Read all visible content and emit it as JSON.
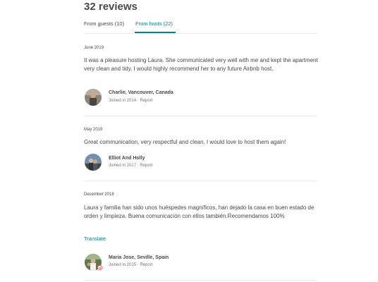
{
  "header": {
    "title": "32 reviews"
  },
  "tabs": [
    {
      "label": "From guests (10)",
      "active": false
    },
    {
      "label": "From hosts (22)",
      "active": true
    }
  ],
  "colors": {
    "accent": "#008489",
    "text": "#484848",
    "muted": "#767676",
    "divider": "#ebebeb",
    "superhost_badge": "#ff5a5f"
  },
  "reviews": [
    {
      "date": "June 2019",
      "text": "It was a pleasure hosting Laura. She communicated very well with me and kept the apartment very clean and tidy. I would highly recommend her to any future Airbnb host.",
      "reviewer": "Charlie, Vancouver, Canada",
      "joined": "Joined in 2014",
      "separator": " · ",
      "report": "Report",
      "avatar_icon": "person-photo-icon"
    },
    {
      "date": "May 2019",
      "text": "Great communication, very respectful and clean, I would love to host them again!",
      "reviewer": "Elliot And Holly",
      "joined": "Joined in 2017",
      "separator": " · ",
      "report": "Report",
      "avatar_icon": "couple-photo-icon"
    },
    {
      "date": "December 2018",
      "text": "Laura y familia han sido unos huéspedes magníficos, han dejado la casa en buen estado de orden y limpieza. Buena comunicación con ellos también.Recomendamos 100%",
      "translate": "Translate",
      "reviewer": "Maria Jose, Seville, Spain",
      "joined": "Joined in 2015",
      "separator": " · ",
      "report": "Report",
      "avatar_icon": "family-photo-icon",
      "superhost_icon": "superhost-badge-icon"
    }
  ]
}
